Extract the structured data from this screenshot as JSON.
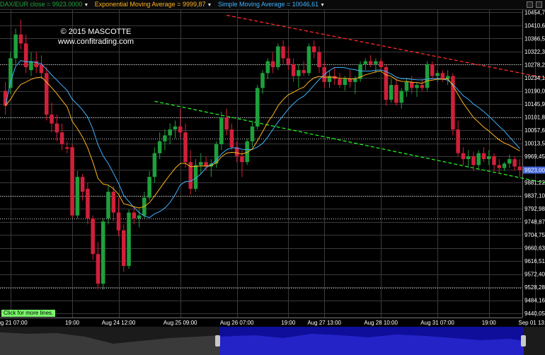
{
  "legend": [
    {
      "text": "DAX/EUR close = 9923.0000",
      "color": "#1ea03c"
    },
    {
      "text": "Exponential Moving Average = 9999,87",
      "color": "#ffb21f"
    },
    {
      "text": "Simple Moving Average = 10046,61",
      "color": "#3fb2ff"
    }
  ],
  "watermark": {
    "line1": "© 2015 MASCOTTE",
    "line2": "www.confitrading.com"
  },
  "more_lines_label": "Click for more lines.",
  "colors": {
    "up": "#1ea03c",
    "down": "#d0203a",
    "ema": "#ffb21f",
    "sma": "#3fb2ff",
    "resistance": "#ff2a2a",
    "support": "#22ee22",
    "grid": "#3a3a3a",
    "level": "#cfcfcf",
    "price_tag_bg": "#3f63d8"
  },
  "chart_data": {
    "type": "candlestick",
    "instrument": "DAX/EUR",
    "ylim": [
      9426,
      10463
    ],
    "y_ticks": [
      10454.74,
      10410.63,
      10366.51,
      10322.39,
      10278.28,
      10234.16,
      10190.04,
      10145.92,
      10101.81,
      10057.69,
      10013.57,
      9969.45,
      9925.34,
      9881.22,
      9837.1,
      9792.98,
      9748.87,
      9704.75,
      9660.63,
      9616.51,
      9572.4,
      9528.28,
      9484.16,
      9440.05
    ],
    "y_tick_labels": [
      "10454,74",
      "10410,63",
      "10366,51",
      "10322,39",
      "10278,28",
      "10234,16",
      "10190,04",
      "10145,92",
      "10101,81",
      "10057,69",
      "10013,57",
      "9969,45",
      "9925,34",
      "9881,22",
      "9837,10",
      "9792,98",
      "9748,87",
      "9704,75",
      "9660,63",
      "9616,51",
      "9572,40",
      "9528,28",
      "9484,16",
      "9440,05"
    ],
    "x_labels": [
      "Aug 21 07:00",
      "19:00",
      "Aug 24 12:00",
      "Aug 25 09:00",
      "Aug 26 07:00",
      "19:00",
      "Aug 27 13:00",
      "Aug 28 10:00",
      "Aug 31 07:00",
      "19:00",
      "Sep 01 13:00"
    ],
    "x_label_bars": [
      1,
      13,
      22,
      34,
      45,
      55,
      62,
      73,
      84,
      94,
      103
    ],
    "last_price": 9923.0,
    "last_price_label": "9923,00",
    "candles": [
      {
        "o": 10190,
        "h": 10220,
        "l": 10110,
        "c": 10140
      },
      {
        "o": 10200,
        "h": 10320,
        "l": 10180,
        "c": 10300
      },
      {
        "o": 10300,
        "h": 10400,
        "l": 10280,
        "c": 10380
      },
      {
        "o": 10380,
        "h": 10430,
        "l": 10330,
        "c": 10350
      },
      {
        "o": 10350,
        "h": 10380,
        "l": 10250,
        "c": 10270
      },
      {
        "o": 10260,
        "h": 10320,
        "l": 10240,
        "c": 10290
      },
      {
        "o": 10290,
        "h": 10320,
        "l": 10250,
        "c": 10270
      },
      {
        "o": 10280,
        "h": 10310,
        "l": 10230,
        "c": 10250
      },
      {
        "o": 10250,
        "h": 10270,
        "l": 10090,
        "c": 10110
      },
      {
        "o": 10110,
        "h": 10150,
        "l": 10050,
        "c": 10080
      },
      {
        "o": 10080,
        "h": 10110,
        "l": 10020,
        "c": 10050
      },
      {
        "o": 10050,
        "h": 10080,
        "l": 9990,
        "c": 10010
      },
      {
        "o": 10000,
        "h": 10020,
        "l": 9980,
        "c": 9995
      },
      {
        "o": 10000,
        "h": 10010,
        "l": 9760,
        "c": 9770
      },
      {
        "o": 9770,
        "h": 9920,
        "l": 9760,
        "c": 9900
      },
      {
        "o": 9900,
        "h": 9910,
        "l": 9820,
        "c": 9850
      },
      {
        "o": 9860,
        "h": 9880,
        "l": 9740,
        "c": 9760
      },
      {
        "o": 9760,
        "h": 9770,
        "l": 9620,
        "c": 9640
      },
      {
        "o": 9640,
        "h": 9680,
        "l": 9520,
        "c": 9540
      },
      {
        "o": 9540,
        "h": 9760,
        "l": 9520,
        "c": 9750
      },
      {
        "o": 9760,
        "h": 9870,
        "l": 9740,
        "c": 9850
      },
      {
        "o": 9850,
        "h": 9870,
        "l": 9750,
        "c": 9780
      },
      {
        "o": 9780,
        "h": 9830,
        "l": 9700,
        "c": 9720
      },
      {
        "o": 9720,
        "h": 9740,
        "l": 9580,
        "c": 9600
      },
      {
        "o": 9600,
        "h": 9790,
        "l": 9590,
        "c": 9780
      },
      {
        "o": 9780,
        "h": 9800,
        "l": 9740,
        "c": 9760
      },
      {
        "o": 9760,
        "h": 9790,
        "l": 9730,
        "c": 9770
      },
      {
        "o": 9770,
        "h": 9850,
        "l": 9760,
        "c": 9830
      },
      {
        "o": 9830,
        "h": 9920,
        "l": 9820,
        "c": 9900
      },
      {
        "o": 9900,
        "h": 10000,
        "l": 9880,
        "c": 9980
      },
      {
        "o": 9980,
        "h": 10050,
        "l": 9960,
        "c": 10020
      },
      {
        "o": 10020,
        "h": 10060,
        "l": 9990,
        "c": 10040
      },
      {
        "o": 10040,
        "h": 10080,
        "l": 10010,
        "c": 10060
      },
      {
        "o": 10060,
        "h": 10090,
        "l": 10030,
        "c": 10070
      },
      {
        "o": 10070,
        "h": 10130,
        "l": 10030,
        "c": 10050
      },
      {
        "o": 10050,
        "h": 10080,
        "l": 9930,
        "c": 9950
      },
      {
        "o": 9950,
        "h": 9990,
        "l": 9840,
        "c": 9860
      },
      {
        "o": 9860,
        "h": 9960,
        "l": 9850,
        "c": 9940
      },
      {
        "o": 9940,
        "h": 9980,
        "l": 9910,
        "c": 9950
      },
      {
        "o": 9950,
        "h": 9970,
        "l": 9920,
        "c": 9935
      },
      {
        "o": 9935,
        "h": 9960,
        "l": 9900,
        "c": 9945
      },
      {
        "o": 9945,
        "h": 10020,
        "l": 9930,
        "c": 10010
      },
      {
        "o": 10010,
        "h": 10120,
        "l": 9990,
        "c": 10100
      },
      {
        "o": 10100,
        "h": 10130,
        "l": 10040,
        "c": 10060
      },
      {
        "o": 10060,
        "h": 10080,
        "l": 9990,
        "c": 10000
      },
      {
        "o": 10000,
        "h": 10020,
        "l": 9950,
        "c": 9970
      },
      {
        "o": 9970,
        "h": 9990,
        "l": 9900,
        "c": 9950
      },
      {
        "o": 9950,
        "h": 10030,
        "l": 9940,
        "c": 10020
      },
      {
        "o": 10020,
        "h": 10090,
        "l": 10000,
        "c": 10070
      },
      {
        "o": 10070,
        "h": 10210,
        "l": 10060,
        "c": 10200
      },
      {
        "o": 10200,
        "h": 10260,
        "l": 10180,
        "c": 10250
      },
      {
        "o": 10250,
        "h": 10300,
        "l": 10230,
        "c": 10290
      },
      {
        "o": 10290,
        "h": 10320,
        "l": 10250,
        "c": 10270
      },
      {
        "o": 10270,
        "h": 10350,
        "l": 10260,
        "c": 10340
      },
      {
        "o": 10340,
        "h": 10360,
        "l": 10280,
        "c": 10300
      },
      {
        "o": 10300,
        "h": 10340,
        "l": 10260,
        "c": 10280
      },
      {
        "o": 10280,
        "h": 10300,
        "l": 10220,
        "c": 10240
      },
      {
        "o": 10240,
        "h": 10280,
        "l": 10200,
        "c": 10260
      },
      {
        "o": 10260,
        "h": 10290,
        "l": 10240,
        "c": 10250
      },
      {
        "o": 10250,
        "h": 10350,
        "l": 10240,
        "c": 10340
      },
      {
        "o": 10340,
        "h": 10360,
        "l": 10300,
        "c": 10320
      },
      {
        "o": 10320,
        "h": 10340,
        "l": 10250,
        "c": 10270
      },
      {
        "o": 10270,
        "h": 10290,
        "l": 10200,
        "c": 10220
      },
      {
        "o": 10220,
        "h": 10260,
        "l": 10200,
        "c": 10240
      },
      {
        "o": 10240,
        "h": 10270,
        "l": 10210,
        "c": 10230
      },
      {
        "o": 10230,
        "h": 10250,
        "l": 10200,
        "c": 10210
      },
      {
        "o": 10210,
        "h": 10240,
        "l": 10190,
        "c": 10230
      },
      {
        "o": 10230,
        "h": 10260,
        "l": 10200,
        "c": 10220
      },
      {
        "o": 10220,
        "h": 10240,
        "l": 10180,
        "c": 10230
      },
      {
        "o": 10230,
        "h": 10290,
        "l": 10220,
        "c": 10280
      },
      {
        "o": 10280,
        "h": 10300,
        "l": 10260,
        "c": 10290
      },
      {
        "o": 10290,
        "h": 10310,
        "l": 10270,
        "c": 10280
      },
      {
        "o": 10280,
        "h": 10300,
        "l": 10250,
        "c": 10290
      },
      {
        "o": 10290,
        "h": 10300,
        "l": 10260,
        "c": 10270
      },
      {
        "o": 10270,
        "h": 10280,
        "l": 10140,
        "c": 10160
      },
      {
        "o": 10160,
        "h": 10230,
        "l": 10150,
        "c": 10210
      },
      {
        "o": 10210,
        "h": 10230,
        "l": 10140,
        "c": 10150
      },
      {
        "o": 10150,
        "h": 10200,
        "l": 10130,
        "c": 10190
      },
      {
        "o": 10190,
        "h": 10230,
        "l": 10170,
        "c": 10220
      },
      {
        "o": 10220,
        "h": 10240,
        "l": 10180,
        "c": 10200
      },
      {
        "o": 10200,
        "h": 10220,
        "l": 10170,
        "c": 10210
      },
      {
        "o": 10210,
        "h": 10230,
        "l": 10190,
        "c": 10200
      },
      {
        "o": 10200,
        "h": 10290,
        "l": 10190,
        "c": 10280
      },
      {
        "o": 10280,
        "h": 10290,
        "l": 10230,
        "c": 10240
      },
      {
        "o": 10240,
        "h": 10260,
        "l": 10220,
        "c": 10250
      },
      {
        "o": 10250,
        "h": 10260,
        "l": 10220,
        "c": 10230
      },
      {
        "o": 10230,
        "h": 10260,
        "l": 10210,
        "c": 10240
      },
      {
        "o": 10240,
        "h": 10250,
        "l": 10040,
        "c": 10060
      },
      {
        "o": 10060,
        "h": 10090,
        "l": 9970,
        "c": 9980
      },
      {
        "o": 9980,
        "h": 10000,
        "l": 9940,
        "c": 9960
      },
      {
        "o": 9960,
        "h": 9990,
        "l": 9930,
        "c": 9970
      },
      {
        "o": 9970,
        "h": 9985,
        "l": 9920,
        "c": 9940
      },
      {
        "o": 9940,
        "h": 9990,
        "l": 9930,
        "c": 9980
      },
      {
        "o": 9980,
        "h": 10000,
        "l": 9950,
        "c": 9960
      },
      {
        "o": 9960,
        "h": 9990,
        "l": 9940,
        "c": 9970
      },
      {
        "o": 9970,
        "h": 9980,
        "l": 9920,
        "c": 9940
      },
      {
        "o": 9940,
        "h": 9960,
        "l": 9910,
        "c": 9930
      },
      {
        "o": 9930,
        "h": 9950,
        "l": 9920,
        "c": 9945
      },
      {
        "o": 9945,
        "h": 9975,
        "l": 9930,
        "c": 9960
      },
      {
        "o": 9960,
        "h": 9970,
        "l": 9920,
        "c": 9935
      },
      {
        "o": 9935,
        "h": 9960,
        "l": 9900,
        "c": 9923
      }
    ],
    "indicators": {
      "ema_label": "Exponential Moving Average",
      "ema_value": 9999.87,
      "sma_label": "Simple Moving Average",
      "sma_value": 10046.61
    },
    "horizontal_levels": [
      10278.28,
      10101.81,
      10030,
      9835,
      9760,
      9525
    ],
    "trend_lines": [
      {
        "name": "resistance",
        "from_bar": 43,
        "from_price": 10445,
        "to_bar": 109,
        "to_price": 10220
      },
      {
        "name": "support",
        "from_bar": 29,
        "from_price": 10155,
        "to_bar": 109,
        "to_price": 9865
      }
    ],
    "grid": true
  }
}
